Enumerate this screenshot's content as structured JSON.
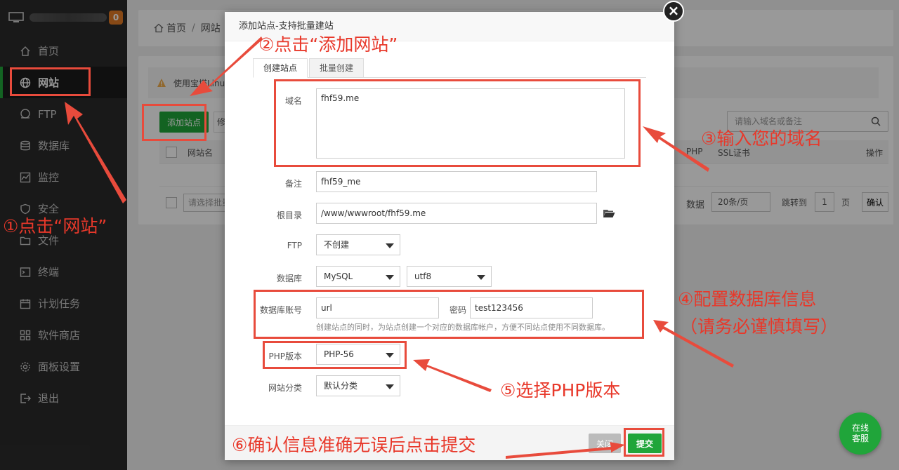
{
  "sidebar": {
    "badge": "0",
    "items": [
      {
        "label": "首页",
        "icon": "home-icon"
      },
      {
        "label": "网站",
        "icon": "globe-icon"
      },
      {
        "label": "FTP",
        "icon": "ftp-icon"
      },
      {
        "label": "数据库",
        "icon": "database-icon"
      },
      {
        "label": "监控",
        "icon": "monitor-chart-icon"
      },
      {
        "label": "安全",
        "icon": "shield-icon"
      },
      {
        "label": "文件",
        "icon": "folder-icon"
      },
      {
        "label": "终端",
        "icon": "terminal-icon"
      },
      {
        "label": "计划任务",
        "icon": "calendar-icon"
      },
      {
        "label": "软件商店",
        "icon": "grid-icon"
      },
      {
        "label": "面板设置",
        "icon": "gear-icon"
      },
      {
        "label": "退出",
        "icon": "logout-icon"
      }
    ]
  },
  "breadcrumb": {
    "home": "首页",
    "current": "网站"
  },
  "main": {
    "warning": "使用宝塔Linux",
    "add_site": "添加站点",
    "modify": "修改",
    "search_placeholder": "请输入域名或备注",
    "columns": {
      "name": "网站名",
      "php": "PHP",
      "ssl": "SSL证书",
      "ops": "操作"
    },
    "batch_placeholder": "请选择批量操",
    "data_label": "数据",
    "per_page": "20条/页",
    "goto": "跳转到",
    "page": "1",
    "page_unit": "页",
    "confirm": "确认"
  },
  "modal": {
    "title": "添加站点-支持批量建站",
    "tabs": [
      "创建站点",
      "批量创建"
    ],
    "domain_label": "域名",
    "domain_value": "fhf59.me",
    "note_label": "备注",
    "note_value": "fhf59_me",
    "root_label": "根目录",
    "root_value": "/www/wwwroot/fhf59.me",
    "ftp_label": "FTP",
    "ftp_value": "不创建",
    "db_label": "数据库",
    "db_value": "MySQL",
    "charset_value": "utf8",
    "db_account_label": "数据库账号",
    "db_user": "url",
    "password_label": "密码",
    "password": "test123456",
    "db_hint": "创建站点的同时，为站点创建一个对应的数据库帐户，方便不同站点使用不同数据库。",
    "php_label": "PHP版本",
    "php_value": "PHP-56",
    "category_label": "网站分类",
    "category_value": "默认分类",
    "close_btn": "关闭",
    "submit_btn": "提交"
  },
  "annotations": {
    "step1": "①点击“网站”",
    "step2": "②点击“添加网站”",
    "step3": "③输入您的域名",
    "step4a": "④配置数据库信息",
    "step4b": "（请务必谨慎填写）",
    "step5": "⑤选择PHP版本",
    "step6": "⑥确认信息准确无误后点击提交"
  },
  "service": {
    "line1": "在线",
    "line2": "客服"
  },
  "colors": {
    "accent": "#20a53a",
    "annotation": "#e84b3c",
    "sidebar": "#2b2b2b",
    "badge": "#e27a25"
  }
}
